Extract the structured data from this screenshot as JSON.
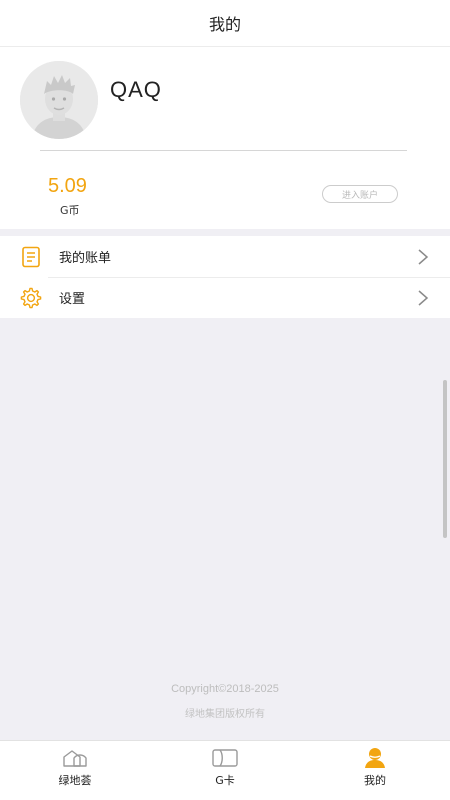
{
  "header": {
    "title": "我的"
  },
  "profile": {
    "username": "QAQ",
    "balance_value": "5.09",
    "balance_unit": "G币",
    "account_button": "进入账户"
  },
  "menu": {
    "items": [
      {
        "label": "我的账单",
        "icon": "bill-icon"
      },
      {
        "label": "设置",
        "icon": "gear-icon"
      }
    ]
  },
  "footer": {
    "copyright": "Copyright©2018-2025",
    "company": "绿地集团版权所有"
  },
  "tabbar": {
    "items": [
      {
        "label": "绿地荟",
        "icon": "home-icon",
        "active": false
      },
      {
        "label": "G卡",
        "icon": "card-icon",
        "active": false
      },
      {
        "label": "我的",
        "icon": "user-icon",
        "active": true
      }
    ]
  },
  "colors": {
    "accent": "#f2a511",
    "background": "#f0eff4",
    "text": "#222222"
  }
}
